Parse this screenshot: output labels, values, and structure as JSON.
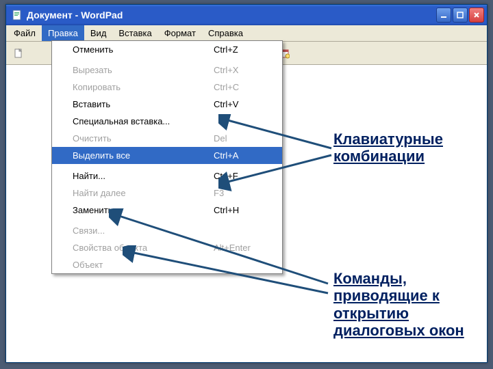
{
  "title": "Документ - WordPad",
  "menubar": [
    "Файл",
    "Правка",
    "Вид",
    "Вставка",
    "Формат",
    "Справка"
  ],
  "dropdown": {
    "items": [
      {
        "label": "Отменить",
        "shortcut": "Ctrl+Z",
        "state": "enabled"
      },
      "sep",
      {
        "label": "Вырезать",
        "shortcut": "Ctrl+X",
        "state": "disabled"
      },
      {
        "label": "Копировать",
        "shortcut": "Ctrl+C",
        "state": "disabled"
      },
      {
        "label": "Вставить",
        "shortcut": "Ctrl+V",
        "state": "enabled"
      },
      {
        "label": "Специальная вставка...",
        "shortcut": "",
        "state": "enabled"
      },
      {
        "label": "Очистить",
        "shortcut": "Del",
        "state": "disabled"
      },
      {
        "label": "Выделить все",
        "shortcut": "Ctrl+A",
        "state": "highlight"
      },
      "sep",
      {
        "label": "Найти...",
        "shortcut": "Ctrl+F",
        "state": "enabled"
      },
      {
        "label": "Найти далее",
        "shortcut": "F3",
        "state": "disabled"
      },
      {
        "label": "Заменить...",
        "shortcut": "Ctrl+H",
        "state": "enabled"
      },
      "sep",
      {
        "label": "Связи...",
        "shortcut": "",
        "state": "disabled"
      },
      {
        "label": "Свойства объекта",
        "shortcut": "Alt+Enter",
        "state": "disabled"
      },
      {
        "label": "Объект",
        "shortcut": "",
        "state": "disabled"
      }
    ]
  },
  "annotations": {
    "keyboard": "Клавиатурные комбинации",
    "dialogs": "Команды, приводящие к открытию диалоговых окон"
  },
  "colors": {
    "titlebar": "#2a5bc7",
    "menubg": "#ece9d8",
    "highlight": "#316ac5",
    "annotation": "#002060",
    "arrow": "#1f4e79"
  }
}
